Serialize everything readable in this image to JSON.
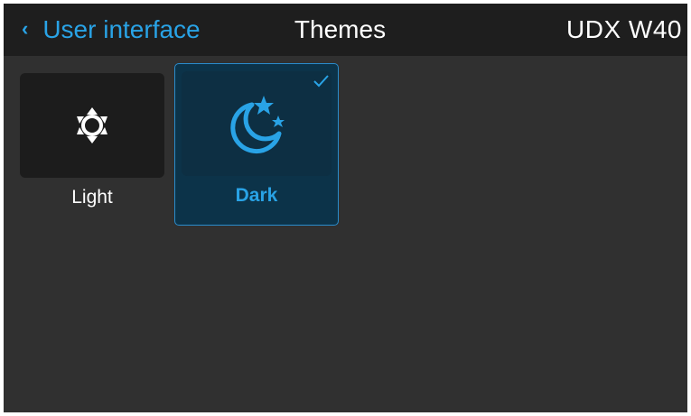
{
  "header": {
    "back_label": "User interface",
    "title": "Themes",
    "device": "UDX W40"
  },
  "themes": [
    {
      "label": "Light",
      "icon": "sun-icon",
      "selected": false
    },
    {
      "label": "Dark",
      "icon": "moon-stars-icon",
      "selected": true
    }
  ],
  "colors": {
    "accent": "#29a3e6",
    "background": "#303030",
    "header": "#1e1e1e",
    "selected_tile": "#0c3349"
  }
}
